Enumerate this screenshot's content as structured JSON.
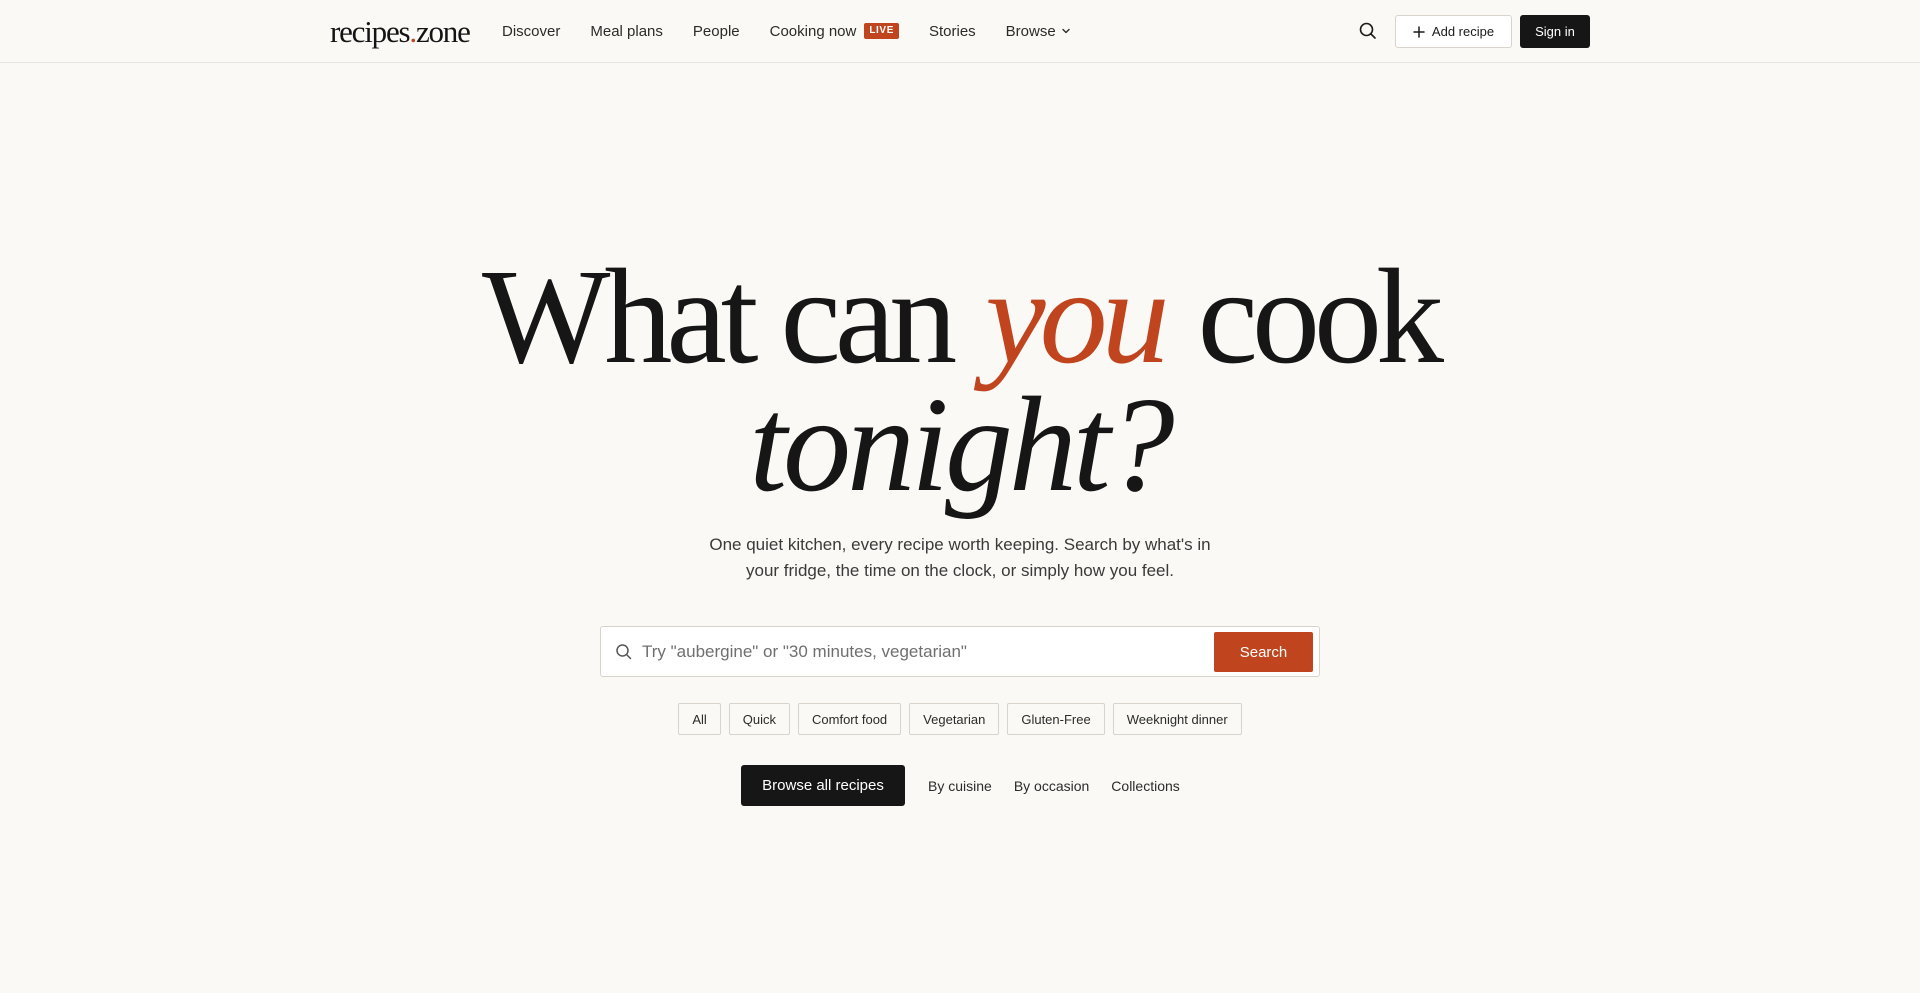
{
  "brand": {
    "name_part1": "recipes",
    "dot": ".",
    "name_part2": "zone"
  },
  "nav": {
    "items": [
      {
        "label": "Discover"
      },
      {
        "label": "Meal plans"
      },
      {
        "label": "People"
      },
      {
        "label": "Cooking now",
        "badge": "LIVE"
      },
      {
        "label": "Stories"
      },
      {
        "label": "Browse",
        "icon": "chevron-down-icon"
      }
    ]
  },
  "header_actions": {
    "search_icon": "search-icon",
    "add_recipe_label": "Add recipe",
    "add_recipe_icon": "plus-icon",
    "sign_in_label": "Sign in"
  },
  "hero": {
    "line1_before": "What can",
    "line1_accent": "you",
    "line1_after": "cook",
    "line2": "tonight?",
    "subtitle_line1": "One quiet kitchen, every recipe worth keeping. Search by what's in",
    "subtitle_line2": "your fridge, the time on the clock, or simply how you feel."
  },
  "search": {
    "value": "",
    "placeholder": "Try \"aubergine\" or \"30 minutes, vegetarian\"",
    "button_label": "Search",
    "icon": "search-icon"
  },
  "chips": [
    "All",
    "Quick",
    "Comfort food",
    "Vegetarian",
    "Gluten-Free",
    "Weeknight dinner"
  ],
  "browse": {
    "button_label": "Browse all recipes",
    "links": [
      "By cuisine",
      "By occasion",
      "Collections"
    ]
  },
  "colors": {
    "background": "#faf9f5",
    "accent": "#c0451f",
    "dark": "#161616",
    "border": "#d8d4cb"
  }
}
